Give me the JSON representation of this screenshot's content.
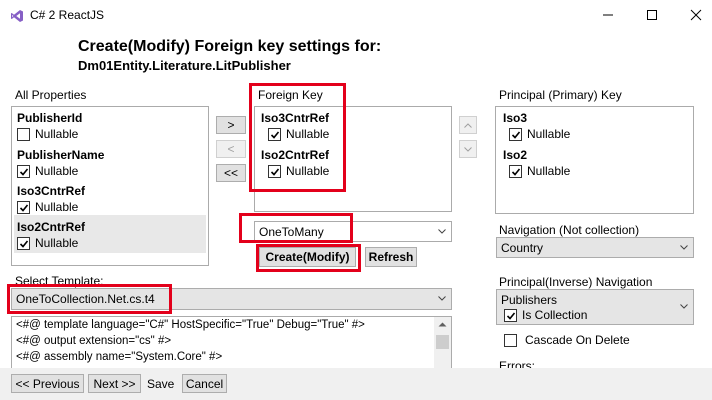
{
  "window": {
    "title": "C# 2 ReactJS",
    "icons": [
      "visual-studio-icon",
      "minimize-icon",
      "maximize-icon",
      "close-icon"
    ]
  },
  "header": {
    "title": "Create(Modify) Foreign key settings for:",
    "entity": "Dm01Entity.Literature.LitPublisher"
  },
  "all_properties": {
    "label": "All Properties",
    "items": [
      {
        "name": "PublisherId",
        "nullable_label": "Nullable",
        "nullable": false
      },
      {
        "name": "PublisherName",
        "nullable_label": "Nullable",
        "nullable": true
      },
      {
        "name": "Iso3CntrRef",
        "nullable_label": "Nullable",
        "nullable": true
      },
      {
        "name": "Iso2CntrRef",
        "nullable_label": "Nullable",
        "nullable": true
      }
    ]
  },
  "move_buttons": {
    "add": ">",
    "remove": "<",
    "remove_all": "<<"
  },
  "foreign_key": {
    "label": "Foreign Key",
    "items": [
      {
        "name": "Iso3CntrRef",
        "nullable_label": "Nullable",
        "nullable": true
      },
      {
        "name": "Iso2CntrRef",
        "nullable_label": "Nullable",
        "nullable": true
      }
    ]
  },
  "order_buttons": {
    "up": "^",
    "down": "v"
  },
  "principal_key": {
    "label": "Principal (Primary) Key",
    "items": [
      {
        "name": "Iso3",
        "nullable_label": "Nullable",
        "nullable": true
      },
      {
        "name": "Iso2",
        "nullable_label": "Nullable",
        "nullable": true
      }
    ]
  },
  "relationship": {
    "selected": "OneToMany"
  },
  "actions": {
    "create_modify": "Create(Modify)",
    "refresh": "Refresh"
  },
  "navigation": {
    "label": "Navigation (Not collection)",
    "selected": "Country"
  },
  "template": {
    "label": "Select Template:",
    "selected": "OneToCollection.Net.cs.t4",
    "lines": [
      "<#@ template language=\"C#\" HostSpecific=\"True\" Debug=\"True\" #>",
      "<#@ output extension=\"cs\" #>",
      "<#@ assembly name=\"System.Core\" #>"
    ]
  },
  "inverse_navigation": {
    "label": "Principal(Inverse) Navigation",
    "selected": "Publishers",
    "is_collection_label": "Is Collection",
    "is_collection": true,
    "cascade_label": "Cascade On Delete",
    "cascade": false,
    "errors_label": "Errors:"
  },
  "footer": {
    "previous": "<< Previous",
    "next": "Next >>",
    "save": "Save",
    "cancel": "Cancel"
  },
  "colors": {
    "highlight": "#e3001b",
    "selected_row": "#e8e8e8",
    "accent_icon": "#865fc5"
  }
}
